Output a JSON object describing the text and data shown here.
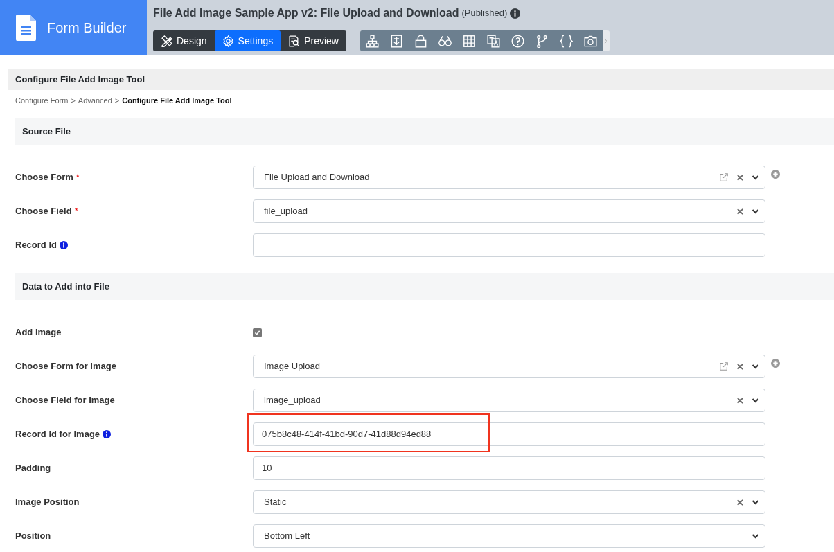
{
  "app": {
    "name": "Form Builder"
  },
  "header": {
    "title": "File Add Image Sample App v2: File Upload and Download",
    "status": "(Published)"
  },
  "tabs": [
    {
      "label": "Design",
      "selected": false
    },
    {
      "label": "Settings",
      "selected": true
    },
    {
      "label": "Preview",
      "selected": false
    }
  ],
  "page": {
    "title": "Configure File Add Image Tool",
    "breadcrumb": [
      {
        "label": "Configure Form",
        "current": false
      },
      {
        "label": "Advanced",
        "current": false
      },
      {
        "label": "Configure File Add Image Tool",
        "current": true
      }
    ],
    "separator": ">"
  },
  "sections": [
    {
      "title": "Source File",
      "rows": [
        {
          "label": "Choose Form",
          "kind": "select",
          "value": "File Upload and Download",
          "required_mark": "*",
          "info": false,
          "link": true,
          "clear": true,
          "add": true,
          "highlighted": false
        },
        {
          "label": "Choose Field",
          "kind": "select",
          "value": "file_upload",
          "required_mark": "*",
          "info": false,
          "link": false,
          "clear": true,
          "add": false,
          "highlighted": false
        },
        {
          "label": "Record Id",
          "kind": "text",
          "value": "",
          "info": true,
          "highlighted": false
        }
      ]
    },
    {
      "title": "Data to Add into File",
      "rows": [
        {
          "label": "Add Image",
          "kind": "checkbox",
          "checked": true,
          "info": false,
          "highlighted": false
        },
        {
          "label": "Choose Form for Image",
          "kind": "select",
          "value": "Image Upload",
          "info": false,
          "link": true,
          "clear": true,
          "add": true,
          "highlighted": false
        },
        {
          "label": "Choose Field for Image",
          "kind": "select",
          "value": "image_upload",
          "info": false,
          "link": false,
          "clear": true,
          "add": false,
          "highlighted": false
        },
        {
          "label": "Record Id for Image",
          "kind": "text",
          "value": "075b8c48-414f-41bd-90d7-41d88d94ed88",
          "info": true,
          "highlighted": true
        },
        {
          "label": "Padding",
          "kind": "text",
          "value": "10",
          "info": false,
          "highlighted": false
        },
        {
          "label": "Image Position",
          "kind": "select",
          "value": "Static",
          "info": false,
          "link": false,
          "clear": true,
          "add": false,
          "highlighted": false
        },
        {
          "label": "Position",
          "kind": "select",
          "value": "Bottom Left",
          "info": false,
          "link": false,
          "clear": false,
          "add": false,
          "highlighted": false
        }
      ]
    }
  ]
}
